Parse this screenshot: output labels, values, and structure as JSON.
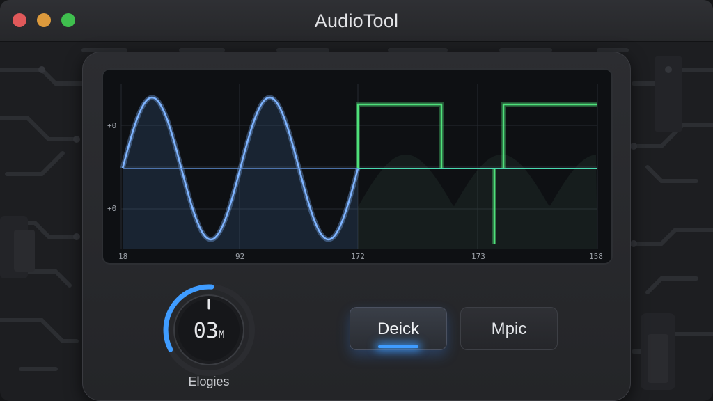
{
  "window": {
    "title": "AudioTool"
  },
  "scope": {
    "y_labels": [
      "+0",
      "+0"
    ],
    "x_labels": [
      "18",
      "92",
      "172",
      "173",
      "158"
    ]
  },
  "knob": {
    "value": "03",
    "unit": "M",
    "label": "Elogies",
    "level": 0.6
  },
  "buttons": {
    "primary": "Deick",
    "secondary": "Mpic"
  },
  "colors": {
    "sine": "#7fb4ff",
    "square": "#4fe07a",
    "accent": "#3f9cff"
  }
}
